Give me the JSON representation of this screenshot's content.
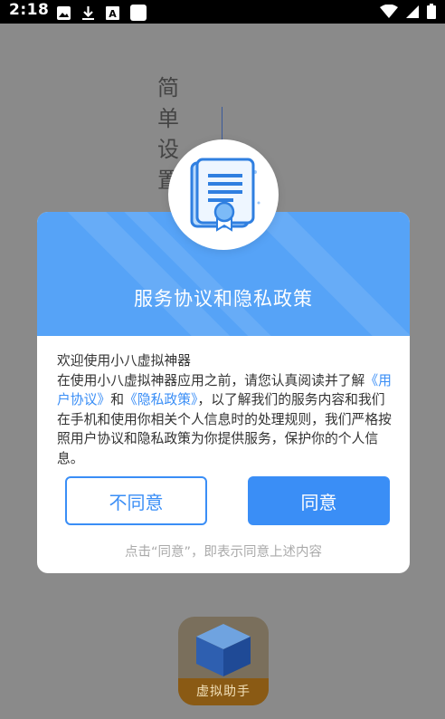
{
  "status_bar": {
    "time": "2:18"
  },
  "background": {
    "title_chars": [
      "简",
      "单",
      "设",
      "置"
    ]
  },
  "dialog": {
    "title": "服务协议和隐私政策",
    "greeting": "欢迎使用小八虚拟神器",
    "body_part1": "在使用小八虚拟神器应用之前，请您认真阅读并了解",
    "user_agreement_link": "《用户协议》",
    "and_text": "和",
    "privacy_policy_link": "《隐私政策》",
    "body_part2": "，以了解我们的服务内容和我们在手机和使用你相关个人信息时的处理规则，我们严格按照用户协议和隐私政策为你提供服务，保护你的个人信息。",
    "disagree_label": "不同意",
    "agree_label": "同意",
    "footnote": "点击“同意”，即表示同意上述内容"
  },
  "app_icon": {
    "label": "虚拟助手"
  },
  "colors": {
    "accent": "#3a8ef6",
    "header": "#56a3f7",
    "overlay": "#8a8a8a"
  }
}
